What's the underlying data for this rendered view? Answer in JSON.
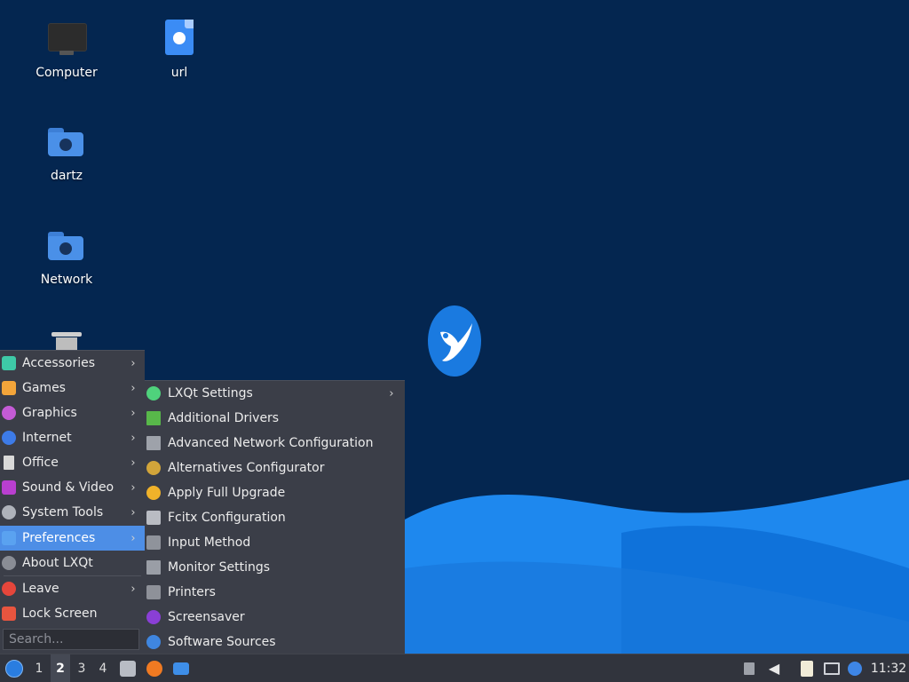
{
  "desktop": {
    "icons": [
      {
        "label": "Computer",
        "icon": "computer-icon"
      },
      {
        "label": "url",
        "icon": "web-link-file-icon"
      },
      {
        "label": "dartz",
        "icon": "home-folder-icon"
      },
      {
        "label": "Network",
        "icon": "network-folder-icon"
      },
      {
        "label": "",
        "icon": "trash-icon"
      }
    ],
    "colors": {
      "background": "#042650",
      "wave_light": "#1e88ee",
      "wave_dark": "#0d6fd6",
      "logo": "#1a7ae0"
    }
  },
  "main_menu": {
    "items": [
      {
        "label": "Accessories",
        "icon": "accessories-icon",
        "color": "#3ec9a7",
        "has_submenu": true
      },
      {
        "label": "Games",
        "icon": "games-icon",
        "color": "#f3a53a",
        "has_submenu": true
      },
      {
        "label": "Graphics",
        "icon": "graphics-icon",
        "color": "#c45bd6",
        "has_submenu": true
      },
      {
        "label": "Internet",
        "icon": "internet-icon",
        "color": "#3d7be8",
        "has_submenu": true
      },
      {
        "label": "Office",
        "icon": "office-icon",
        "color": "#d9d9d9",
        "has_submenu": true
      },
      {
        "label": "Sound & Video",
        "icon": "sound-video-icon",
        "color": "#b93fd0",
        "has_submenu": true
      },
      {
        "label": "System Tools",
        "icon": "system-tools-icon",
        "color": "#aeb2ba",
        "has_submenu": true
      },
      {
        "label": "Preferences",
        "icon": "preferences-icon",
        "color": "#5aa2f0",
        "has_submenu": true,
        "active": true
      },
      {
        "label": "About LXQt",
        "icon": "info-icon",
        "color": "#8a8d95",
        "has_submenu": false
      },
      {
        "label": "Leave",
        "icon": "power-icon",
        "color": "#e5463b",
        "has_submenu": true
      },
      {
        "label": "Lock Screen",
        "icon": "lock-icon",
        "color": "#e8553f",
        "has_submenu": false
      }
    ],
    "search_placeholder": "Search..."
  },
  "sub_menu": {
    "items": [
      {
        "label": "LXQt Settings",
        "icon": "lxqt-settings-icon",
        "color": "#4fd27c",
        "has_submenu": true
      },
      {
        "label": "Additional Drivers",
        "icon": "drivers-icon",
        "color": "#58b84a",
        "has_submenu": false
      },
      {
        "label": "Advanced Network Configuration",
        "icon": "network-config-icon",
        "color": "#9ea2aa",
        "has_submenu": false
      },
      {
        "label": "Alternatives Configurator",
        "icon": "alternatives-icon",
        "color": "#d2a53a",
        "has_submenu": false
      },
      {
        "label": "Apply Full Upgrade",
        "icon": "upgrade-icon",
        "color": "#f0b22a",
        "has_submenu": false
      },
      {
        "label": "Fcitx Configuration",
        "icon": "keyboard-icon",
        "color": "#b9bcc3",
        "has_submenu": false
      },
      {
        "label": "Input Method",
        "icon": "keyboard-icon",
        "color": "#8f939b",
        "has_submenu": false
      },
      {
        "label": "Monitor Settings",
        "icon": "monitor-icon",
        "color": "#9a9ea6",
        "has_submenu": false
      },
      {
        "label": "Printers",
        "icon": "printer-icon",
        "color": "#8e9199",
        "has_submenu": false
      },
      {
        "label": "Screensaver",
        "icon": "screensaver-icon",
        "color": "#8a3fd6",
        "has_submenu": false
      },
      {
        "label": "Software Sources",
        "icon": "software-sources-icon",
        "color": "#3f86e0",
        "has_submenu": false
      }
    ]
  },
  "taskbar": {
    "workspaces": [
      "1",
      "2",
      "3",
      "4"
    ],
    "current_workspace": "2",
    "launchers": [
      {
        "icon": "file-manager-icon",
        "color": "#b8bcc4"
      },
      {
        "icon": "firefox-icon",
        "color": "#f07a22"
      },
      {
        "icon": "desktop-show-icon",
        "color": "#3e8ee8"
      }
    ],
    "tray": [
      {
        "icon": "tray-expand-icon"
      },
      {
        "icon": "volume-icon"
      },
      {
        "icon": "clipboard-icon"
      },
      {
        "icon": "network-wired-icon"
      },
      {
        "icon": "update-notifier-icon"
      }
    ],
    "clock": "11:32"
  }
}
